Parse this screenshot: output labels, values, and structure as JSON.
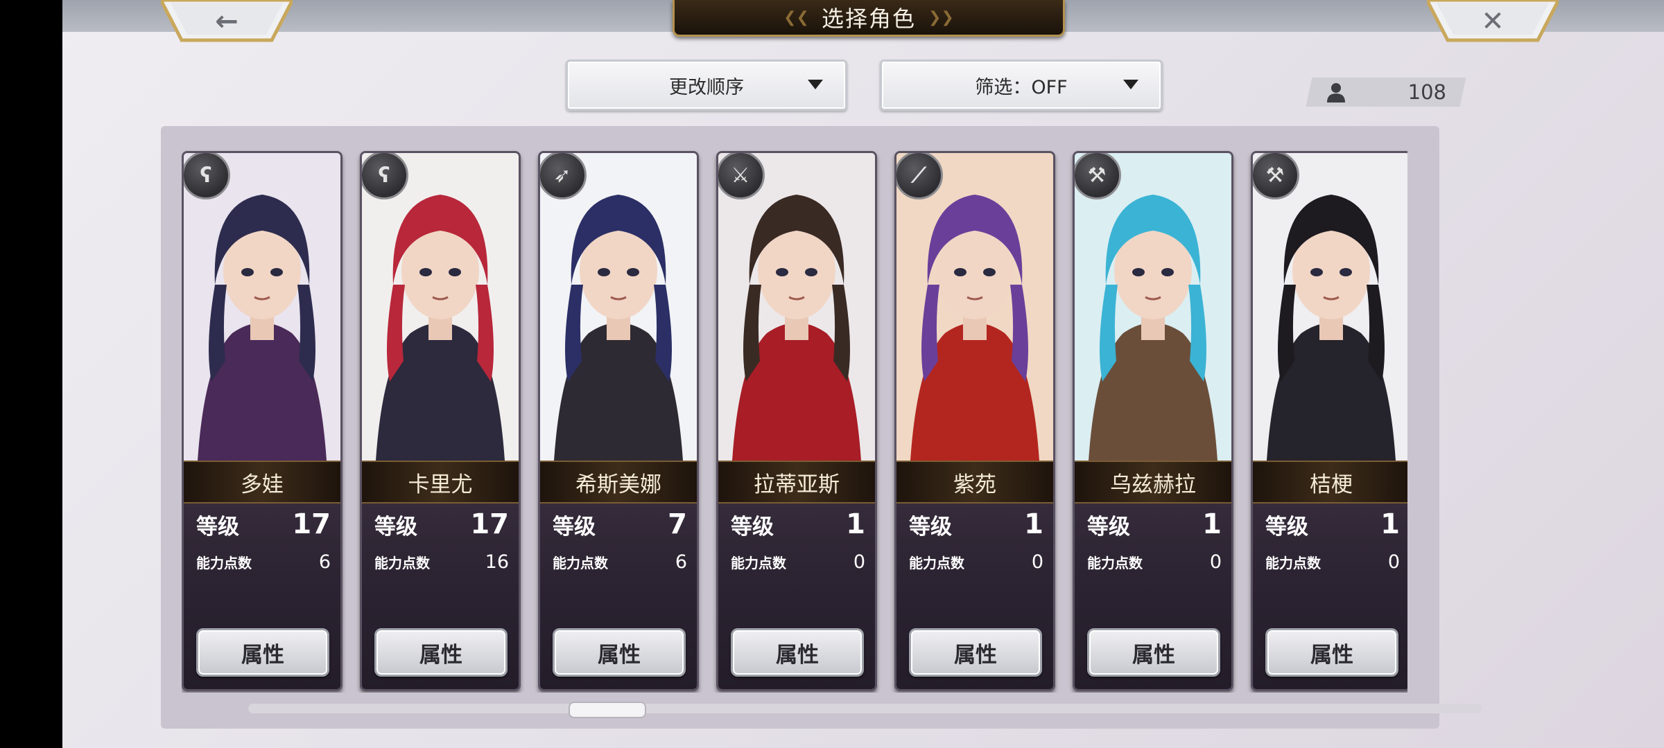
{
  "header": {
    "title": "选择角色",
    "back_icon": "arrow-left-icon",
    "close_icon": "close-x-icon"
  },
  "toolbar": {
    "sort_label": "更改顺序",
    "filter_label": "筛选：OFF",
    "character_count": "108"
  },
  "labels": {
    "level": "等级",
    "ability_points": "能力点数",
    "attribute_button": "属性"
  },
  "colors": {
    "name_plate_text": "#f5ecd6",
    "panel_background": "#c9c4cf"
  },
  "characters": [
    {
      "name": "多娃",
      "level": "17",
      "ability_points": "6",
      "weapon_icon": "staff-icon",
      "hair": "#2e2c4e",
      "bg": "#e9e4ee",
      "outfit": "#4a2a58"
    },
    {
      "name": "卡里尤",
      "level": "17",
      "ability_points": "16",
      "weapon_icon": "staff-icon",
      "hair": "#b8273a",
      "bg": "#f1efee",
      "outfit": "#2c2a3c"
    },
    {
      "name": "希斯美娜",
      "level": "7",
      "ability_points": "6",
      "weapon_icon": "spear-icon",
      "hair": "#2b2f66",
      "bg": "#f2f3f6",
      "outfit": "#2e2a33"
    },
    {
      "name": "拉蒂亚斯",
      "level": "1",
      "ability_points": "0",
      "weapon_icon": "sword-icon",
      "hair": "#3a2a24",
      "bg": "#ece8ea",
      "outfit": "#a81d26"
    },
    {
      "name": "紫苑",
      "level": "1",
      "ability_points": "0",
      "weapon_icon": "katana-icon",
      "hair": "#6a3f9a",
      "bg": "#f0d8c4",
      "outfit": "#b3261f"
    },
    {
      "name": "乌兹赫拉",
      "level": "1",
      "ability_points": "0",
      "weapon_icon": "axe-icon",
      "hair": "#3bb3d4",
      "bg": "#dbeef2",
      "outfit": "#6b4e3a"
    },
    {
      "name": "桔梗",
      "level": "1",
      "ability_points": "0",
      "weapon_icon": "axe-icon",
      "hair": "#1d1a20",
      "bg": "#efeef1",
      "outfit": "#25232b"
    }
  ]
}
